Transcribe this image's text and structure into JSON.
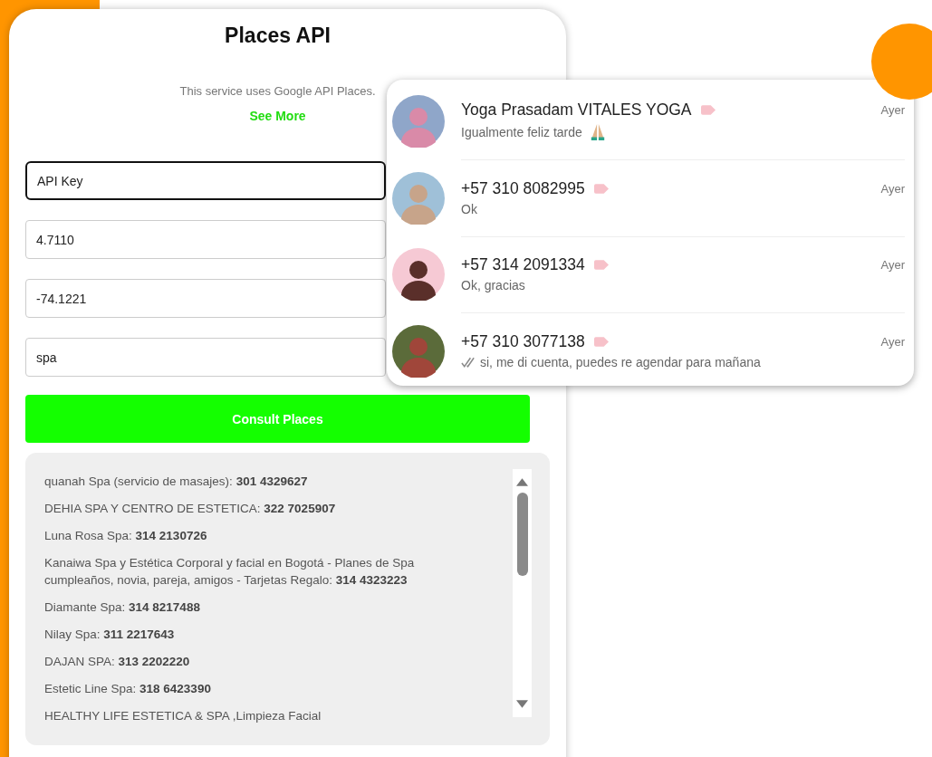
{
  "card": {
    "title": "Places API",
    "description": "This service uses Google API Places.",
    "link": "See More",
    "fields": [
      {
        "placeholder": "API Key",
        "focused": true
      },
      {
        "value": "4.7110",
        "focused": false
      },
      {
        "value": "-74.1221",
        "focused": false
      },
      {
        "value": "spa",
        "focused": false
      }
    ],
    "button": "Consult Places",
    "results": [
      "quanah Spa (servicio de masajes): **301 4329627**",
      "DEHIA SPA Y CENTRO DE ESTETICA: **322 7025907**",
      "Luna Rosa Spa: **314 2130726**",
      "Kanaiwa Spa y Estética Corporal y facial en Bogotá - Planes de Spa cumpleaños, novia, pareja, amigos - Tarjetas Regalo: **314 4323223**",
      "Diamante Spa: **314 8217488**",
      "Nilay Spa: **311 2217643**",
      "DAJAN SPA: **313 2202220**",
      "Estetic Line Spa: **318 6423390**",
      "HEALTHY LIFE ESTETICA & SPA ,Limpieza Facial"
    ]
  },
  "chats": [
    {
      "name": "Yoga Prasadam VITALES YOGA",
      "message": "Igualmente feliz tarde",
      "emoji": true,
      "read_ticks": false,
      "time": "Ayer"
    },
    {
      "name": "+57 310 8082995",
      "message": "Ok",
      "emoji": false,
      "read_ticks": false,
      "time": "Ayer"
    },
    {
      "name": "+57 314 2091334",
      "message": "Ok, gracias",
      "emoji": false,
      "read_ticks": false,
      "time": "Ayer"
    },
    {
      "name": "+57 310 3077138",
      "message": "si, me di cuenta, puedes re agendar para mañana",
      "emoji": false,
      "read_ticks": true,
      "time": "Ayer"
    }
  ]
}
